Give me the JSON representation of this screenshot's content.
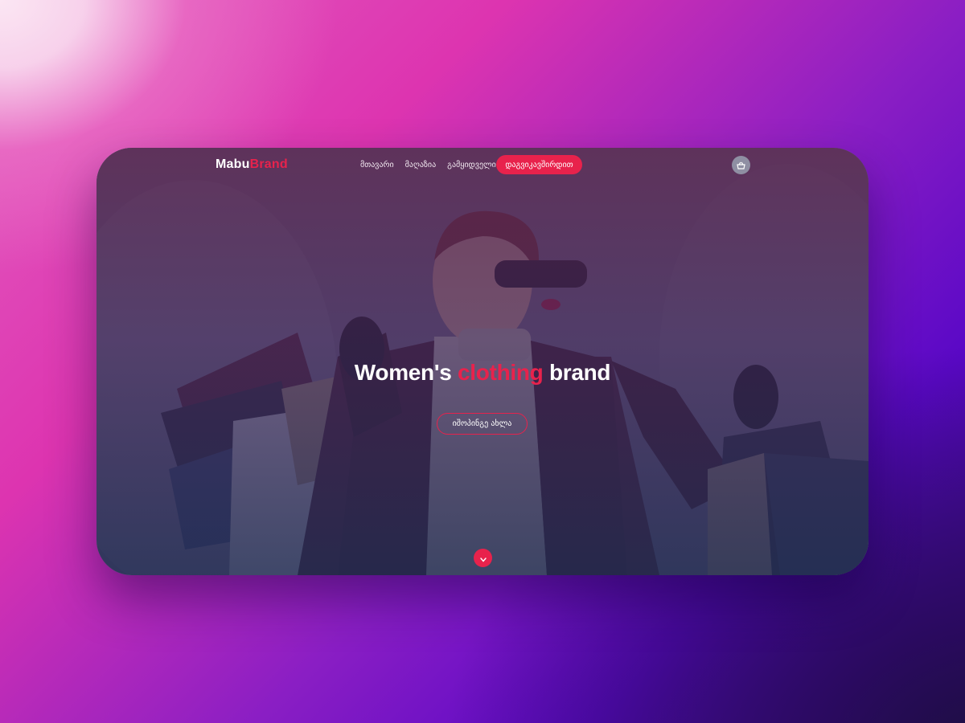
{
  "nav": {
    "logo_part1": "Mabu",
    "logo_part2": "Brand",
    "menu": [
      {
        "label": "მთავარი"
      },
      {
        "label": "მაღაზია"
      },
      {
        "label": "გამყიდველი"
      }
    ],
    "cta_label": "დაგვიკავშირდით",
    "cart_icon": "basket-icon"
  },
  "hero": {
    "headline_part1": "Women's",
    "headline_accent": "clothing",
    "headline_part2": "brand",
    "button_label": "იშოპინგე ახლა",
    "scroll_icon": "chevron-down-icon"
  },
  "colors": {
    "accent": "#e8224c",
    "cart_bg": "#8f8fa3"
  }
}
